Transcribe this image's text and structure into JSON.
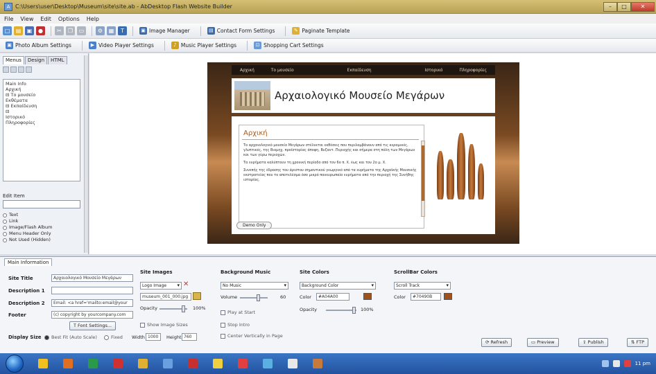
{
  "window": {
    "title": "C:\\Users\\user\\Desktop\\Museum\\site\\site.ab - AbDesktop Flash Website Builder",
    "min": "–",
    "max": "□",
    "close": "✕"
  },
  "menu": [
    "File",
    "View",
    "Edit",
    "Options",
    "Help"
  ],
  "toolbar1": {
    "image_manager": "Image Manager",
    "contact_form": "Contact Form Settings",
    "pagination": "Paginate Template"
  },
  "toolbar2": {
    "photo_album": "Photo Album Settings",
    "video_player": "Video Player Settings",
    "music_player": "Music Player Settings",
    "shopping_cart": "Shopping Cart Settings"
  },
  "left_panel": {
    "tabs": [
      "Menus",
      "Design",
      "HTML"
    ],
    "tree": [
      "Main Info",
      "  Αρχική",
      "⊟ Το μουσείο",
      "    Εκθέματα",
      "⊟ Εκπαίδευση",
      "⊟",
      "    Ιστορικό",
      "    Πληροφορίες"
    ],
    "edit_item_label": "Edit Item",
    "radios": [
      "Text",
      "Link",
      "Image/Flash Album",
      "Menu Header Only",
      "Not Used (Hidden)"
    ]
  },
  "site": {
    "nav": [
      "Αρχική",
      "Το μουσείο",
      "Εκπαίδευση",
      "Ιστορικό",
      "Πληροφορίες"
    ],
    "title": "Αρχαιολογικό Μουσείο Μεγάρων",
    "content_title": "Αρχική",
    "paragraphs": [
      "Το αρχαιολογικό μουσείο Μεγάρων στέλνεται εκθέσεις που περιλαμβάνουν από τις κεραμικές, γλυπτικές, της Βιομηχ. προϊστορίας άποψη, Βυζαντ. Περιοχής και σήμερα στη πόλη των Μεγάρων και των γύρω περιοχών.",
      "Τα ευρήματα καλύπτουν τη χρονική περίοδο από τον 6ο π. Χ. έως και τον 2ο μ. Χ.",
      "Συνεπής της έδρασης του άριστου σημαντικού γεωργικό από τα ευρήματα της Αρχαϊκής Μουσικής εκστρατείας που το αποτελέσμα όσο μικρό πανευρωπαίο ευρήματα από την περιοχή της Συνήθης ιστορίας."
    ],
    "demo_button": "Demo Only"
  },
  "bottom": {
    "tab": "Main Information",
    "site_title_label": "Site Title",
    "site_title_value": "Αρχαιολογικό Μουσείο Μεγάρων",
    "desc1_label": "Description 1",
    "desc1_value": "",
    "desc2_label": "Description 2",
    "desc2_value": "Email: <a href='mailto:email@your",
    "footer_label": "Footer",
    "footer_value": "(c) copyright by yourcompany.com",
    "font_settings": "Font Settings...",
    "display_size_label": "Display Size",
    "display_opts": [
      "Best Fit (Auto Scale)",
      "Fixed"
    ],
    "width_label": "Width",
    "width_value": "1000",
    "height_label": "Height",
    "height_value": "760",
    "site_images_header": "Site Images",
    "logo_select": "Logo Image",
    "logo_file": "museum_001_000.jpg",
    "opacity_label": "Opacity",
    "opacity_value": "100%",
    "show_image_sizes": "Show Image Sizes",
    "bg_music_header": "Background Music",
    "music_select": "No Music",
    "volume_label": "Volume",
    "volume_value": "60",
    "play_at_start": "Play at Start",
    "stop_intro": "Stop Intro",
    "center_vertically": "Center Vertically in Page",
    "site_colors_header": "Site Colors",
    "site_color_select": "Background Color",
    "color_label": "Color",
    "color_value": "#A04A00",
    "opacity2_label": "Opacity",
    "opacity2_value": "100%",
    "scrollbar_header": "ScrollBar Colors",
    "scroll_select": "Scroll Track",
    "scroll_color_label": "Color",
    "scroll_color_value": "#70490B"
  },
  "actions": {
    "refresh": "Refresh",
    "preview": "Preview",
    "publish": "Publish",
    "ftp": "FTP"
  },
  "tray": {
    "time": "11 pm"
  },
  "colors": {
    "accent": "#a0521c",
    "title_bar": "#c9b56a",
    "taskbar": "#2f66b4"
  }
}
